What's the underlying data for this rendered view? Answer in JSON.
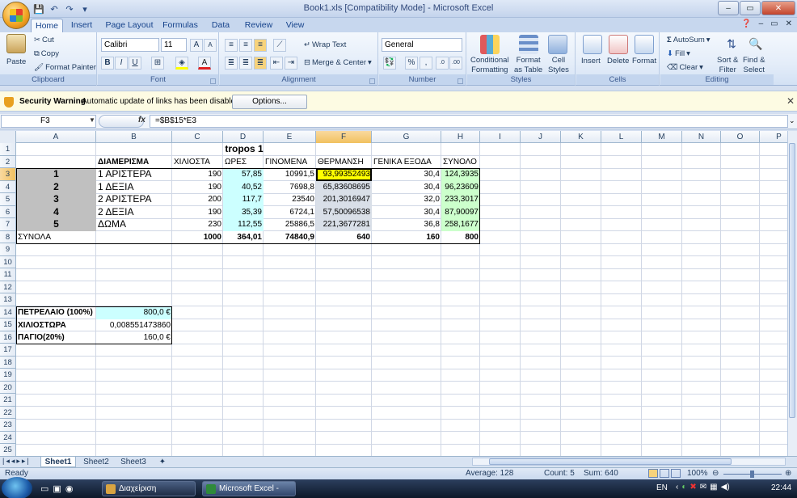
{
  "window": {
    "title": "Book1.xls  [Compatibility Mode] - Microsoft Excel",
    "minimize": "–",
    "maximize": "▭",
    "close": "✕"
  },
  "ribbon_tabs": [
    "Home",
    "Insert",
    "Page Layout",
    "Formulas",
    "Data",
    "Review",
    "View"
  ],
  "ribbon": {
    "clipboard": {
      "label": "Clipboard",
      "paste": "Paste",
      "cut": "Cut",
      "copy": "Copy",
      "format_painter": "Format Painter"
    },
    "font": {
      "label": "Font",
      "font_name": "Calibri",
      "font_size": "11",
      "bold": "B",
      "italic": "I",
      "underline": "U"
    },
    "alignment": {
      "label": "Alignment",
      "wrap_text": "Wrap Text",
      "merge_center": "Merge & Center"
    },
    "number": {
      "label": "Number",
      "format": "General",
      "percent": "%",
      "comma": ","
    },
    "styles": {
      "label": "Styles",
      "conditional": "Conditional",
      "conditional2": "Formatting",
      "format_table": "Format",
      "format_table2": "as Table",
      "cell_styles": "Cell",
      "cell_styles2": "Styles"
    },
    "cells": {
      "label": "Cells",
      "insert": "Insert",
      "delete": "Delete",
      "format": "Format"
    },
    "editing": {
      "label": "Editing",
      "autosum": "AutoSum",
      "fill": "Fill",
      "clear": "Clear",
      "sort": "Sort &",
      "sort2": "Filter",
      "find": "Find &",
      "find2": "Select"
    }
  },
  "security_bar": {
    "title": "Security Warning",
    "message": "Automatic update of links has been disabled",
    "options_button": "Options..."
  },
  "formula_bar": {
    "name_box": "F3",
    "fx": "fx",
    "formula": "=$B$15*E3"
  },
  "columns": [
    "A",
    "B",
    "C",
    "D",
    "E",
    "F",
    "G",
    "H",
    "I",
    "J",
    "K",
    "L",
    "M",
    "N",
    "O",
    "P"
  ],
  "rows": [
    "1",
    "2",
    "3",
    "4",
    "5",
    "6",
    "7",
    "8",
    "9",
    "10",
    "11",
    "12",
    "13",
    "14",
    "15",
    "16",
    "17",
    "18",
    "19",
    "20",
    "21",
    "22",
    "23",
    "24",
    "25"
  ],
  "sheet": {
    "title": "tropos 1",
    "headers": [
      "ΔΙΑΜΕΡΙΣΜΑ",
      "ΧΙΛΙΟΣΤΑ",
      "ΩΡΕΣ",
      "ΓΙΝΟΜΕΝΑ",
      "ΘΕΡΜΑΝΣΗ",
      "ΓΕΝΙΚΑ ΕΞΟΔΑ",
      "ΣΥΝΟΛΟ"
    ],
    "data_rows": [
      {
        "a": "1",
        "b": "1 ΑΡΙΣΤΕΡΑ",
        "c": "190",
        "d": "57,85",
        "e": "10991,5",
        "f": "93,99352493",
        "g": "30,4",
        "h": "124,3935"
      },
      {
        "a": "2",
        "b": "1 ΔΕΞΙΑ",
        "c": "190",
        "d": "40,52",
        "e": "7698,8",
        "f": "65,83608695",
        "g": "30,4",
        "h": "96,23609"
      },
      {
        "a": "3",
        "b": "2 ΑΡΙΣΤΕΡΑ",
        "c": "200",
        "d": "117,7",
        "e": "23540",
        "f": "201,3016947",
        "g": "32,0",
        "h": "233,3017"
      },
      {
        "a": "4",
        "b": "2 ΔΕΞΙΑ",
        "c": "190",
        "d": "35,39",
        "e": "6724,1",
        "f": "57,50096538",
        "g": "30,4",
        "h": "87,90097"
      },
      {
        "a": "5",
        "b": "ΔΩΜΑ",
        "c": "230",
        "d": "112,55",
        "e": "25886,5",
        "f": "221,3677281",
        "g": "36,8",
        "h": "258,1677"
      }
    ],
    "totals": {
      "label": "ΣΥΝΟΛΑ",
      "c": "1000",
      "d": "364,01",
      "e": "74840,9",
      "f": "640",
      "g": "160",
      "h": "800"
    },
    "params": [
      {
        "label": "ΠΕΤΡΕΛΑΙΟ (100%)",
        "value": "800,0 €"
      },
      {
        "label": "ΧΙΛΙΟΣΤΩΡΑ",
        "value": "0,008551473860"
      },
      {
        "label": "ΠΑΓΙΟ(20%)",
        "value": "160,0 €"
      }
    ]
  },
  "sheet_tabs": [
    "Sheet1",
    "Sheet2",
    "Sheet3"
  ],
  "status_bar": {
    "ready": "Ready",
    "average": "Average: 128",
    "count": "Count: 5",
    "sum": "Sum: 640",
    "zoom": "100%"
  },
  "taskbar": {
    "items": [
      "Διαχείριση Επισυνα...",
      "Microsoft Excel - Bo..."
    ],
    "lang": "EN",
    "clock": "22:44"
  },
  "colors": {
    "highlight_yellow": "#ffff00",
    "cyan_fill": "#ccffff",
    "green_fill": "#ccffcc",
    "gray_fill": "#c0c0c0",
    "selected_header": "#f1c15f"
  }
}
